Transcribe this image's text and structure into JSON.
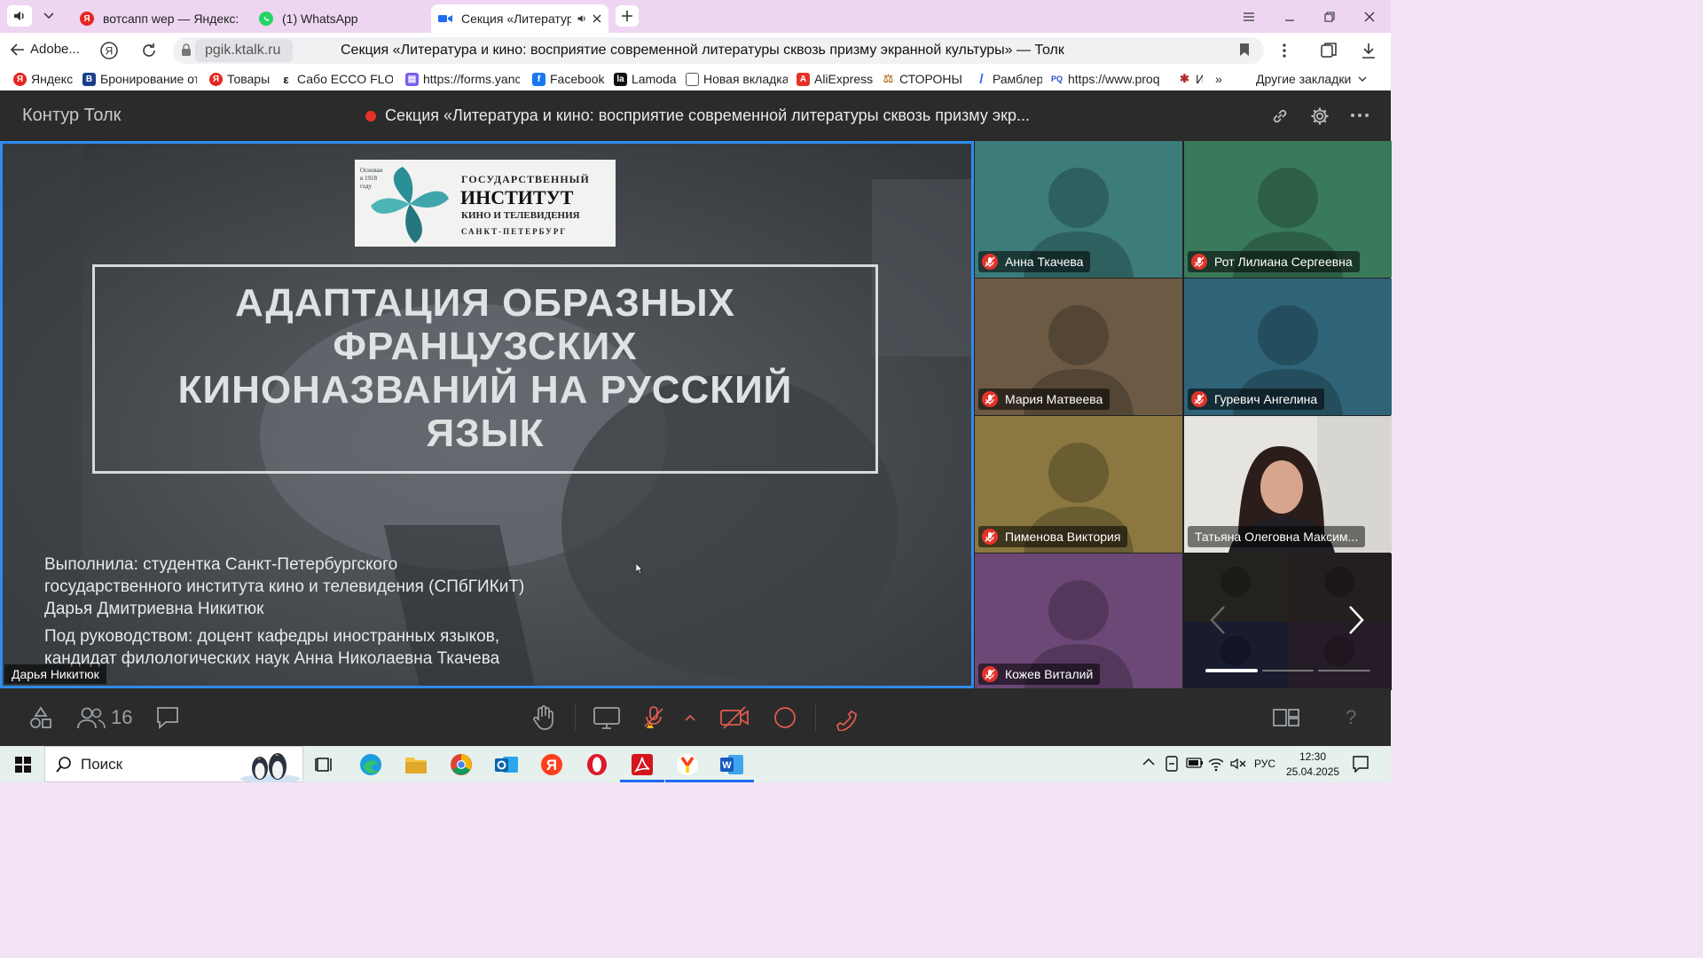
{
  "browser": {
    "tabs": [
      {
        "title": "вотсапп wep — Яндекс: на",
        "icon": "yandex-icon",
        "color": "#e52620"
      },
      {
        "title": "(1) WhatsApp",
        "icon": "whatsapp-icon",
        "color": "#25d366"
      },
      {
        "title": "Секция «Литератур",
        "icon": "video-icon",
        "color": "#1e6cf0",
        "active": true
      }
    ],
    "address": {
      "back_label": "Adobe...",
      "url": "pgik.ktalk.ru",
      "page_title": "Секция «Литература и кино: восприятие современной литературы сквозь призму экранной культуры» — Толк"
    },
    "bookmarks": [
      {
        "label": "Яндекс",
        "icon": "yandex-icon"
      },
      {
        "label": "Бронирование от",
        "icon": "booking-icon"
      },
      {
        "label": "Товары",
        "icon": "yandex-icon"
      },
      {
        "label": "Сабо ECCO FLOW",
        "icon": "ecco-icon"
      },
      {
        "label": "https://forms.yanc",
        "icon": "forms-icon"
      },
      {
        "label": "Facebook",
        "icon": "facebook-icon"
      },
      {
        "label": "Lamoda",
        "icon": "lamoda-icon"
      },
      {
        "label": "Новая вкладка",
        "icon": "page-icon"
      },
      {
        "label": "AliExpress",
        "icon": "aliexpress-icon"
      },
      {
        "label": "СТОРОНЫ",
        "icon": "scales-icon"
      },
      {
        "label": "Рамблер",
        "icon": "rambler-icon"
      },
      {
        "label": "https://www.proq",
        "icon": "pq-icon"
      },
      {
        "label": "И",
        "icon": "maple-icon"
      }
    ],
    "bookmarks_more": "»",
    "other_bookmarks": "Другие закладки"
  },
  "app": {
    "brand": "Контур Толк",
    "meeting_title": "Секция «Литература и кино: восприятие современной литературы сквозь призму экр...",
    "recording_color": "#e5332a"
  },
  "slide": {
    "logo": {
      "founded": [
        "Основан",
        "в 1918",
        "году"
      ],
      "line1": "ГОСУДАРСТВЕННЫЙ",
      "line2": "ИНСТИТУТ",
      "line3": "КИНО И ТЕЛЕВИДЕНИЯ",
      "line4": "САНКТ-ПЕТЕРБУРГ"
    },
    "title": [
      "АДАПТАЦИЯ ОБРАЗНЫХ",
      "ФРАНЦУЗСКИХ",
      "КИНОНАЗВАНИЙ НА РУССКИЙ",
      "ЯЗЫК"
    ],
    "author": [
      "Выполнила: студентка Санкт-Петербургского",
      "государственного института кино и телевидения (СПбГИКиТ)",
      "Дарья Дмитриевна Никитюк"
    ],
    "supervisor": [
      "Под руководством: доцент кафедры иностранных языков,",
      "кандидат филологических наук Анна Николаевна Ткачева"
    ],
    "speaker_name": "Дарья Никитюк"
  },
  "participants": [
    {
      "name": "Анна Ткачева",
      "bg": "#3c7c7a",
      "muted": true
    },
    {
      "name": "Рот Лилиана Сергеевна",
      "bg": "#3a7a5c",
      "muted": true
    },
    {
      "name": "Мария Матвеева",
      "bg": "#6c5a44",
      "muted": true
    },
    {
      "name": "Гуревич Ангелина",
      "bg": "#2f6478",
      "muted": true
    },
    {
      "name": "Пименова Виктория",
      "bg": "#8a7840",
      "muted": true
    },
    {
      "name": "Татьяна Олеговна Максим...",
      "bg": "#e3e1dc",
      "muted": false,
      "video": true
    },
    {
      "name": "Кожев Виталий",
      "bg": "#6b4876",
      "muted": true
    }
  ],
  "toolbar": {
    "participants_count": "16",
    "help": "?"
  },
  "taskbar": {
    "search_placeholder": "Поиск",
    "lang": "РУС",
    "time": "12:30",
    "date": "25.04.2025"
  }
}
